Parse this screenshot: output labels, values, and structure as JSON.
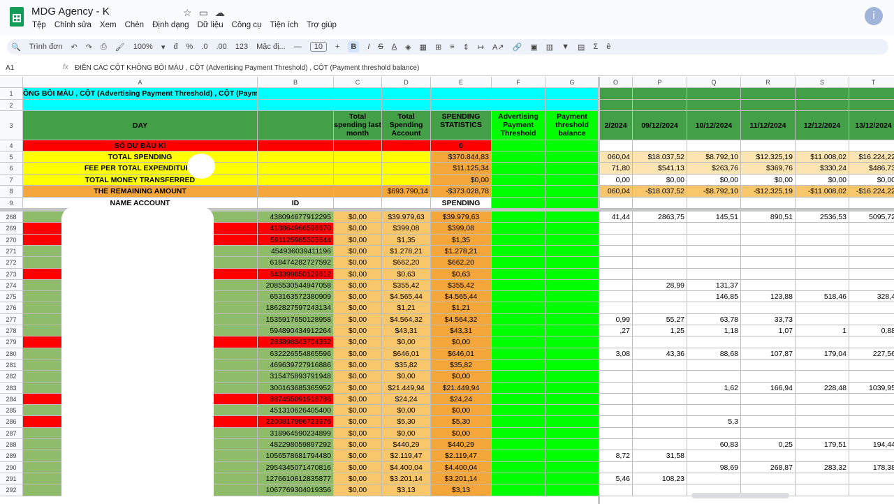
{
  "app": {
    "title": "MDG Agency - K",
    "menus": [
      "Tệp",
      "Chỉnh sửa",
      "Xem",
      "Chèn",
      "Định dạng",
      "Dữ liệu",
      "Công cụ",
      "Tiện ích",
      "Trợ giúp"
    ]
  },
  "toolbar": {
    "search": "Trình đơn",
    "zoom": "100%",
    "currency": "đ",
    "percent": "%",
    "dec_down": ".0",
    "dec_up": ".00",
    "num_fmt": "123",
    "font": "Mặc đị...",
    "font_size": "10",
    "bold": "B",
    "italic": "I",
    "strike": "S",
    "underline": "A"
  },
  "formula": {
    "cell_ref": "A1",
    "fx": "fx",
    "text": "ĐIỀN CÁC CỘT KHÔNG BÔI MÀU , CỘT (Advertising Payment Threshold) , CỘT (Payment threshold balance)"
  },
  "columns": [
    "A",
    "B",
    "C",
    "D",
    "E",
    "F",
    "G",
    "O",
    "P",
    "Q",
    "R",
    "S",
    "T"
  ],
  "top": {
    "r1": "ÔNG BÔI MÀU , CỘT (Advertising Payment Threshold) , CỘT (Paymen",
    "day": "DAY",
    "h_c": "Total spending last month",
    "h_d": "Total Spending Account",
    "h_e": "SPENDING STATISTICS",
    "h_f": "Advertising Payment Threshold",
    "h_g": "Payment threshold balance",
    "dates": [
      "2/2024",
      "09/12/2024",
      "10/12/2024",
      "11/12/2024",
      "12/12/2024",
      "13/12/2024"
    ],
    "r4a": "SỐ DƯ ĐẦU KÌ",
    "r4e": "0",
    "r5a": "TOTAL SPENDING",
    "r5e": "$370.844,83",
    "r5v": [
      "060,04",
      "$18.037,52",
      "$8.792,10",
      "$12.325,19",
      "$11.008,02",
      "$16.224,22"
    ],
    "r6a": "FEE PER TOTAL EXPENDITURE",
    "r6e": "$11.125,34",
    "r6v": [
      "71,80",
      "$541,13",
      "$263,76",
      "$369,76",
      "$330,24",
      "$486,73"
    ],
    "r7a": "TOTAL MONEY TRANSFERRED",
    "r7e": "$0,00",
    "r7v": [
      "0,00",
      "$0,00",
      "$0,00",
      "$0,00",
      "$0,00",
      "$0,00"
    ],
    "r8a": "THE REMAINING AMOUNT",
    "r8d": "$693.790,14",
    "r8e": "-$373.028,78",
    "r8v": [
      "060,04",
      "-$18.037,52",
      "-$8.792,10",
      "-$12.325,19",
      "-$11.008,02",
      "-$16.224,22"
    ],
    "r9a": "NAME ACCOUNT",
    "r9b": "ID",
    "r9e": "SPENDING"
  },
  "rows": [
    {
      "n": "268",
      "red": false,
      "id": "438094677912295",
      "c": "$0,00",
      "d": "$39.979,63",
      "e": "$39.979,63",
      "o": "41,44",
      "p": "2863,75",
      "q": "145,51",
      "r": "890,51",
      "s": "2536,53",
      "t": "5095,72"
    },
    {
      "n": "269",
      "red": true,
      "id": "418864966596670",
      "c": "$0,00",
      "d": "$399,08",
      "e": "$399,08",
      "o": "",
      "p": "",
      "q": "",
      "r": "",
      "s": "",
      "t": ""
    },
    {
      "n": "270",
      "red": true,
      "id": "591125985305644",
      "c": "$0,00",
      "d": "$1,35",
      "e": "$1,35",
      "o": "",
      "p": "",
      "q": "",
      "r": "",
      "s": "",
      "t": ""
    },
    {
      "n": "271",
      "red": false,
      "id": "454936039411196",
      "c": "$0,00",
      "d": "$1.278,21",
      "e": "$1.278,21",
      "o": "",
      "p": "",
      "q": "",
      "r": "",
      "s": "",
      "t": ""
    },
    {
      "n": "272",
      "red": false,
      "id": "618474282727592",
      "c": "$0,00",
      "d": "$662,20",
      "e": "$662,20",
      "o": "",
      "p": "",
      "q": "",
      "r": "",
      "s": "",
      "t": ""
    },
    {
      "n": "273",
      "red": true,
      "id": "643399850129612",
      "c": "$0,00",
      "d": "$0,63",
      "e": "$0,63",
      "o": "",
      "p": "",
      "q": "",
      "r": "",
      "s": "",
      "t": ""
    },
    {
      "n": "274",
      "red": false,
      "id": "2085530544947058",
      "c": "$0,00",
      "d": "$355,42",
      "e": "$355,42",
      "o": "",
      "p": "28,99",
      "q": "131,37",
      "r": "",
      "s": "",
      "t": ""
    },
    {
      "n": "275",
      "red": false,
      "id": "653163572380909",
      "c": "$0,00",
      "d": "$4.565,44",
      "e": "$4.565,44",
      "o": "",
      "p": "",
      "q": "146,85",
      "r": "123,88",
      "s": "518,46",
      "t": "328,4"
    },
    {
      "n": "276",
      "red": false,
      "id": "1862827597243134",
      "c": "$0,00",
      "d": "$1,21",
      "e": "$1,21",
      "o": "",
      "p": "",
      "q": "",
      "r": "",
      "s": "",
      "t": ""
    },
    {
      "n": "277",
      "red": false,
      "id": "1535917650128958",
      "c": "$0,00",
      "d": "$4.564,32",
      "e": "$4.564,32",
      "o": "0,99",
      "p": "55,27",
      "q": "63,78",
      "r": "33,73",
      "s": "",
      "t": ""
    },
    {
      "n": "278",
      "red": false,
      "id": "594890434912264",
      "c": "$0,00",
      "d": "$43,31",
      "e": "$43,31",
      "o": ",27",
      "p": "1,25",
      "q": "1,18",
      "r": "1,07",
      "s": "1",
      "t": "0,88"
    },
    {
      "n": "279",
      "red": true,
      "id": "283898343704352",
      "c": "$0,00",
      "d": "$0,00",
      "e": "$0,00",
      "o": "",
      "p": "",
      "q": "",
      "r": "",
      "s": "",
      "t": ""
    },
    {
      "n": "280",
      "red": false,
      "id": "632226554865596",
      "c": "$0,00",
      "d": "$646,01",
      "e": "$646,01",
      "o": "3,08",
      "p": "43,36",
      "q": "88,68",
      "r": "107,87",
      "s": "179,04",
      "t": "227,56"
    },
    {
      "n": "281",
      "red": false,
      "id": "469639727916886",
      "c": "$0,00",
      "d": "$35,82",
      "e": "$35,82",
      "o": "",
      "p": "",
      "q": "",
      "r": "",
      "s": "",
      "t": ""
    },
    {
      "n": "282",
      "red": false,
      "id": "315475893791948",
      "c": "$0,00",
      "d": "$0,00",
      "e": "$0,00",
      "o": "",
      "p": "",
      "q": "",
      "r": "",
      "s": "",
      "t": ""
    },
    {
      "n": "283",
      "red": false,
      "id": "300163685365952",
      "c": "$0,00",
      "d": "$21.449,94",
      "e": "$21.449,94",
      "o": "",
      "p": "",
      "q": "1,62",
      "r": "166,94",
      "s": "228,48",
      "t": "1039,95"
    },
    {
      "n": "284",
      "red": true,
      "id": "887455091916786",
      "c": "$0,00",
      "d": "$24,24",
      "e": "$24,24",
      "o": "",
      "p": "",
      "q": "",
      "r": "",
      "s": "",
      "t": ""
    },
    {
      "n": "285",
      "red": false,
      "id": "451310626405400",
      "c": "$0,00",
      "d": "$0,00",
      "e": "$0,00",
      "o": "",
      "p": "",
      "q": "",
      "r": "",
      "s": "",
      "t": ""
    },
    {
      "n": "286",
      "red": true,
      "id": "2200817996723976",
      "c": "$0,00",
      "d": "$5,30",
      "e": "$5,30",
      "o": "",
      "p": "",
      "q": "5,3",
      "r": "",
      "s": "",
      "t": ""
    },
    {
      "n": "287",
      "red": false,
      "id": "318964590234899",
      "c": "$0,00",
      "d": "$0,00",
      "e": "$0,00",
      "o": "",
      "p": "",
      "q": "",
      "r": "",
      "s": "",
      "t": ""
    },
    {
      "n": "288",
      "red": false,
      "id": "482298059897292",
      "c": "$0,00",
      "d": "$440,29",
      "e": "$440,29",
      "o": "",
      "p": "",
      "q": "60,83",
      "r": "0,25",
      "s": "179,51",
      "t": "194,44"
    },
    {
      "n": "289",
      "red": false,
      "id": "1056578681794480",
      "c": "$0,00",
      "d": "$2.119,47",
      "e": "$2.119,47",
      "o": "8,72",
      "p": "31,58",
      "q": "",
      "r": "",
      "s": "",
      "t": ""
    },
    {
      "n": "290",
      "red": false,
      "id": "2954345071470816",
      "c": "$0,00",
      "d": "$4.400,04",
      "e": "$4.400,04",
      "o": "",
      "p": "",
      "q": "98,69",
      "r": "268,87",
      "s": "283,32",
      "t": "178,38"
    },
    {
      "n": "291",
      "red": false,
      "id": "1276610612835877",
      "c": "$0,00",
      "d": "$3.201,14",
      "e": "$3.201,14",
      "o": "5,46",
      "p": "108,23",
      "q": "",
      "r": "",
      "s": "",
      "t": ""
    },
    {
      "n": "292",
      "red": false,
      "id": "1067769304019356",
      "c": "$0,00",
      "d": "$3,13",
      "e": "$3,13",
      "o": "",
      "p": "",
      "q": "",
      "r": "",
      "s": "",
      "t": ""
    }
  ],
  "colors": {
    "green": "#8fbc6a",
    "red": "#ff0000",
    "yellow": "#ffff00",
    "orange": "#f4a63a",
    "cyan": "#00ffff",
    "lime": "#00ff00",
    "darkgreen": "#43a047",
    "tan": "#fce5b0",
    "orange_light": "#f9c76b"
  }
}
